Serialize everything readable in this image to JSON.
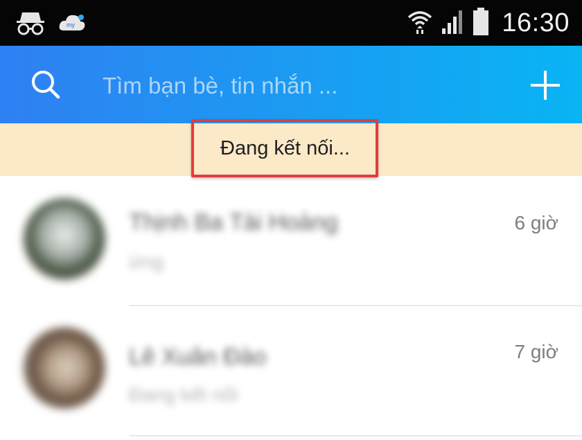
{
  "status_bar": {
    "left_icons": [
      "incognito-icon",
      "my-cloud-icon"
    ],
    "right_icons": [
      "wifi-icon",
      "cell-signal-icon",
      "battery-icon"
    ],
    "time": "16:30"
  },
  "header": {
    "search_placeholder": "Tìm bạn bè, tin nhắn ...",
    "search_icon": "search-icon",
    "add_icon": "plus-icon",
    "colors": {
      "gradient_start": "#2f80f2",
      "gradient_end": "#08b4f4"
    }
  },
  "connection_banner": {
    "text": "Đang kết nối...",
    "background": "#fbe9c8",
    "highlight_color": "#e23c3c"
  },
  "conversations": [
    {
      "name": "Thịnh Ba Tài Hoàng",
      "preview": "ừng",
      "time": "6 giờ"
    },
    {
      "name": "Lê Xuân Đào",
      "preview": "Đang kết nối",
      "time": "7 giờ"
    }
  ]
}
